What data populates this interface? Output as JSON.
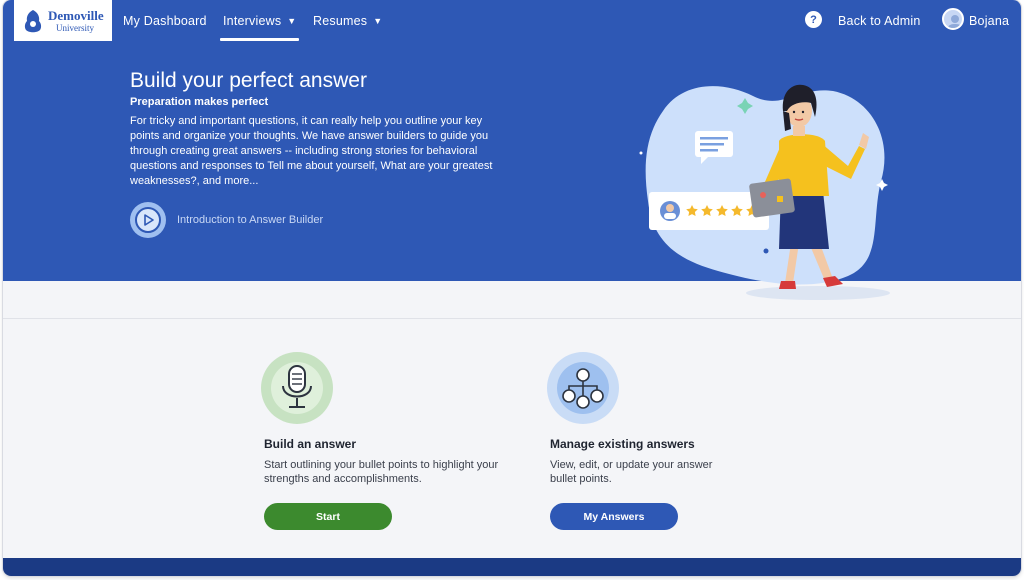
{
  "logo": {
    "name": "Demoville",
    "sub": "University"
  },
  "nav": {
    "dashboard": "My Dashboard",
    "interviews": "Interviews",
    "resumes": "Resumes",
    "help": "?",
    "back_to_admin": "Back to Admin",
    "user_name": "Bojana"
  },
  "hero": {
    "title": "Build your perfect answer",
    "subtitle": "Preparation makes perfect",
    "body": "For tricky and important questions, it can really help you outline your key points and organize your thoughts. We have answer builders to guide you through creating great answers -- including strong stories for behavioral questions and responses to Tell me about yourself, What are your greatest weaknesses?, and more...",
    "video_link": "Introduction to Answer Builder"
  },
  "cards": [
    {
      "title": "Build an answer",
      "description": "Start outlining your bullet points to highlight your strengths and accomplishments.",
      "button": "Start",
      "icon": "microphone-icon",
      "color": "#3c8a2e"
    },
    {
      "title": "Manage existing answers",
      "description": "View, edit, or update your answer bullet points.",
      "button": "My Answers",
      "icon": "hierarchy-icon",
      "color": "#2e58b5"
    }
  ],
  "colors": {
    "primary": "#2e58b5",
    "success": "#3c8a2e",
    "footer": "#1b3a84"
  }
}
